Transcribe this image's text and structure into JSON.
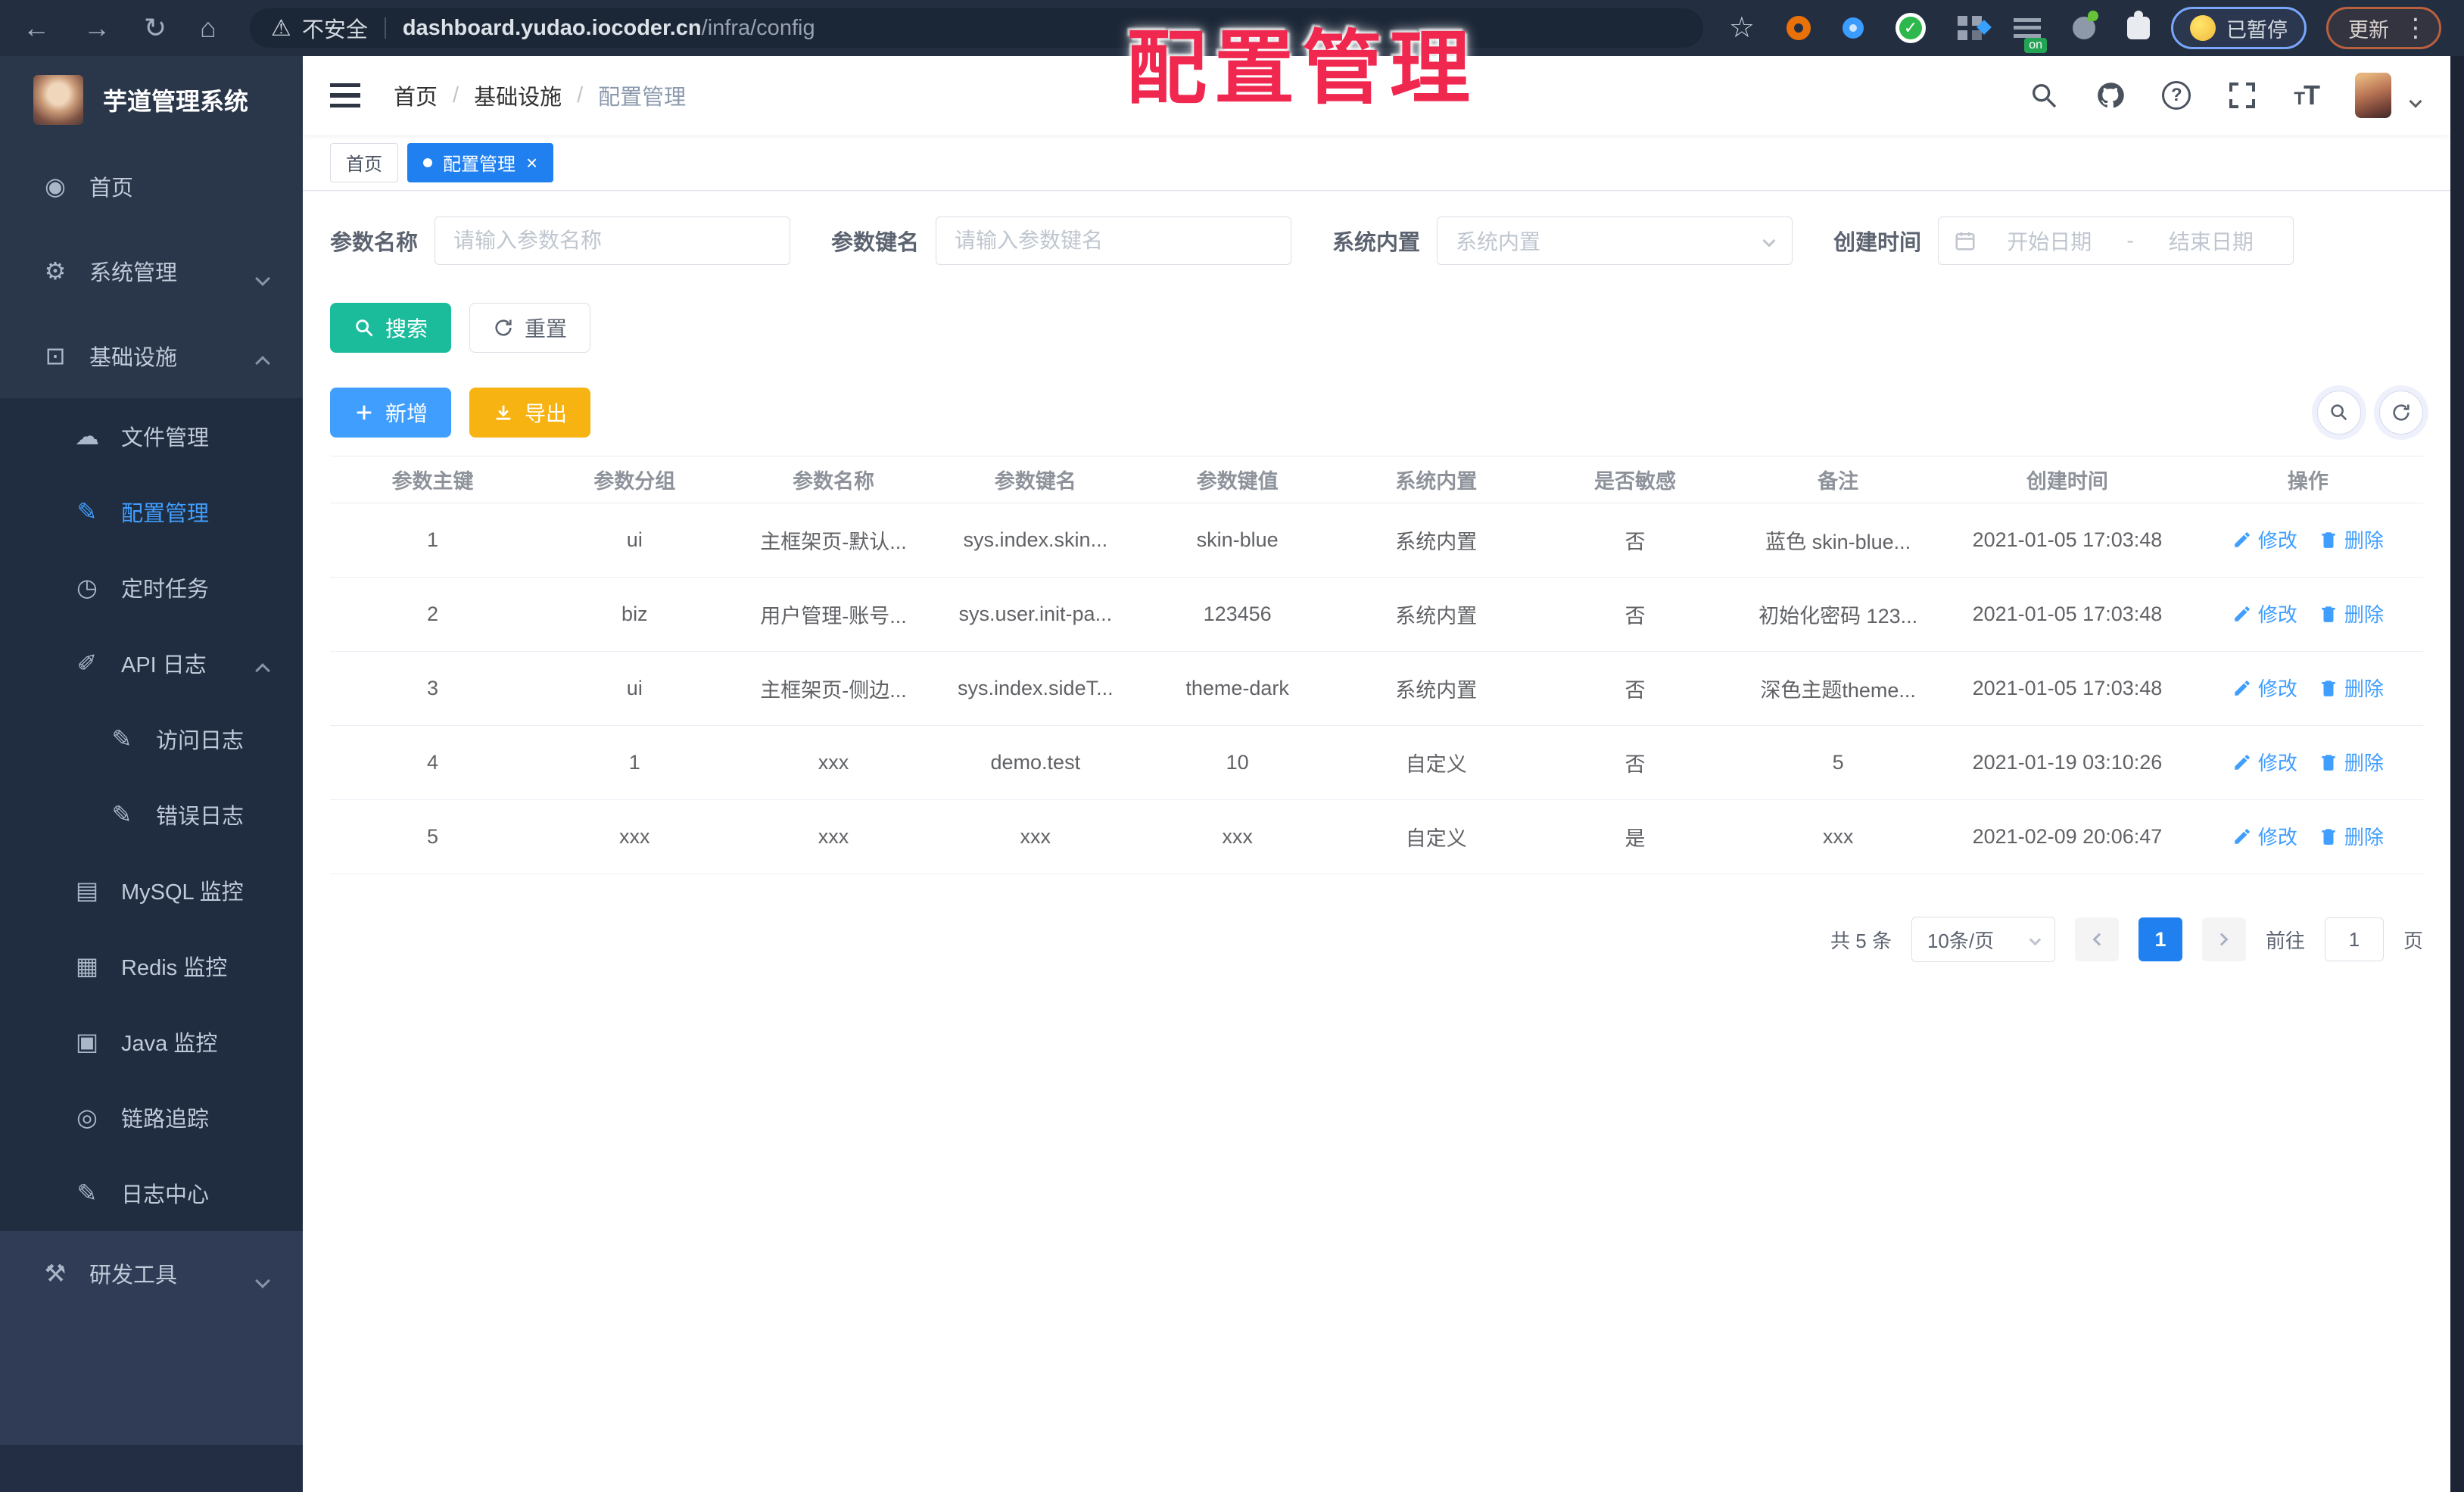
{
  "browser": {
    "security_label": "不安全",
    "url_host": "dashboard.yudao.iocoder.cn",
    "url_path": "/infra/config",
    "paused_badge": "已暂停",
    "update_button": "更新"
  },
  "overlay": {
    "title": "配置管理"
  },
  "colors": {
    "accent": "#409eff",
    "search_button": "#1abc9c",
    "export_button": "#f7b312",
    "tag_active": "#2080f0",
    "overlay_text": "#f0284f",
    "sidebar_bg": "#2a3649",
    "sidebar_submenu_bg": "#202c3f",
    "browser_bar_bg": "#232e41"
  },
  "sidebar": {
    "app_title": "芋道管理系统",
    "items": [
      {
        "id": "home",
        "label": "首页",
        "icon": "dashboard-icon",
        "glyph": "◉",
        "level": 0
      },
      {
        "id": "system-management",
        "label": "系统管理",
        "icon": "gear-icon",
        "glyph": "⚙",
        "level": 0,
        "chevron": "down"
      },
      {
        "id": "infrastructure",
        "label": "基础设施",
        "icon": "monitor-chart-icon",
        "glyph": "⊡",
        "level": 0,
        "chevron": "up"
      },
      {
        "id": "file-management",
        "label": "文件管理",
        "icon": "cloud-icon",
        "glyph": "☁",
        "level": 1,
        "submenu": true
      },
      {
        "id": "config-management",
        "label": "配置管理",
        "icon": "edit-box-icon",
        "glyph": "✎",
        "level": 1,
        "submenu": true,
        "active": true
      },
      {
        "id": "scheduled-tasks",
        "label": "定时任务",
        "icon": "timer-icon",
        "glyph": "◷",
        "level": 1,
        "submenu": true
      },
      {
        "id": "api-log",
        "label": "API 日志",
        "icon": "log-icon",
        "glyph": "✐",
        "level": 1,
        "submenu": true,
        "chevron": "up"
      },
      {
        "id": "access-log",
        "label": "访问日志",
        "icon": "access-log-icon",
        "glyph": "✎",
        "level": 2,
        "submenu": true
      },
      {
        "id": "error-log",
        "label": "错误日志",
        "icon": "error-log-icon",
        "glyph": "✎",
        "level": 2,
        "submenu": true
      },
      {
        "id": "mysql-monitor",
        "label": "MySQL 监控",
        "icon": "mysql-icon",
        "glyph": "▤",
        "level": 1,
        "submenu": true
      },
      {
        "id": "redis-monitor",
        "label": "Redis 监控",
        "icon": "redis-icon",
        "glyph": "▦",
        "level": 1,
        "submenu": true
      },
      {
        "id": "java-monitor",
        "label": "Java 监控",
        "icon": "java-icon",
        "glyph": "▣",
        "level": 1,
        "submenu": true
      },
      {
        "id": "trace",
        "label": "链路追踪",
        "icon": "eye-icon",
        "glyph": "◎",
        "level": 1,
        "submenu": true
      },
      {
        "id": "log-center",
        "label": "日志中心",
        "icon": "log-center-icon",
        "glyph": "✎",
        "level": 1,
        "submenu": true
      },
      {
        "id": "dev-tools",
        "label": "研发工具",
        "icon": "toolbox-icon",
        "glyph": "⚒",
        "level": 0,
        "chevron": "down",
        "footer": true
      }
    ]
  },
  "header": {
    "breadcrumb": [
      "首页",
      "基础设施",
      "配置管理"
    ]
  },
  "tags": [
    {
      "label": "首页"
    },
    {
      "label": "配置管理",
      "active": true,
      "closable": true
    }
  ],
  "filters": {
    "name_label": "参数名称",
    "name_placeholder": "请输入参数名称",
    "key_label": "参数键名",
    "key_placeholder": "请输入参数键名",
    "type_label": "系统内置",
    "type_placeholder": "系统内置",
    "date_label": "创建时间",
    "date_start_placeholder": "开始日期",
    "date_separator": "-",
    "date_end_placeholder": "结束日期",
    "search_button": "搜索",
    "reset_button": "重置"
  },
  "toolbar": {
    "add_button": "新增",
    "export_button": "导出"
  },
  "table": {
    "columns": [
      "参数主键",
      "参数分组",
      "参数名称",
      "参数键名",
      "参数键值",
      "系统内置",
      "是否敏感",
      "备注",
      "创建时间",
      "操作"
    ],
    "rows": [
      [
        "1",
        "ui",
        "主框架页-默认...",
        "sys.index.skin...",
        "skin-blue",
        "系统内置",
        "否",
        "蓝色 skin-blue...",
        "2021-01-05 17:03:48"
      ],
      [
        "2",
        "biz",
        "用户管理-账号...",
        "sys.user.init-pa...",
        "123456",
        "系统内置",
        "否",
        "初始化密码 123...",
        "2021-01-05 17:03:48"
      ],
      [
        "3",
        "ui",
        "主框架页-侧边...",
        "sys.index.sideT...",
        "theme-dark",
        "系统内置",
        "否",
        "深色主题theme...",
        "2021-01-05 17:03:48"
      ],
      [
        "4",
        "1",
        "xxx",
        "demo.test",
        "10",
        "自定义",
        "否",
        "5",
        "2021-01-19 03:10:26"
      ],
      [
        "5",
        "xxx",
        "xxx",
        "xxx",
        "xxx",
        "自定义",
        "是",
        "xxx",
        "2021-02-09 20:06:47"
      ]
    ],
    "actions": {
      "edit": "修改",
      "delete": "删除"
    }
  },
  "pagination": {
    "total": "共 5 条",
    "page_size": "10条/页",
    "current_page": "1",
    "goto_label": "前往",
    "goto_value": "1",
    "page_label": "页"
  }
}
